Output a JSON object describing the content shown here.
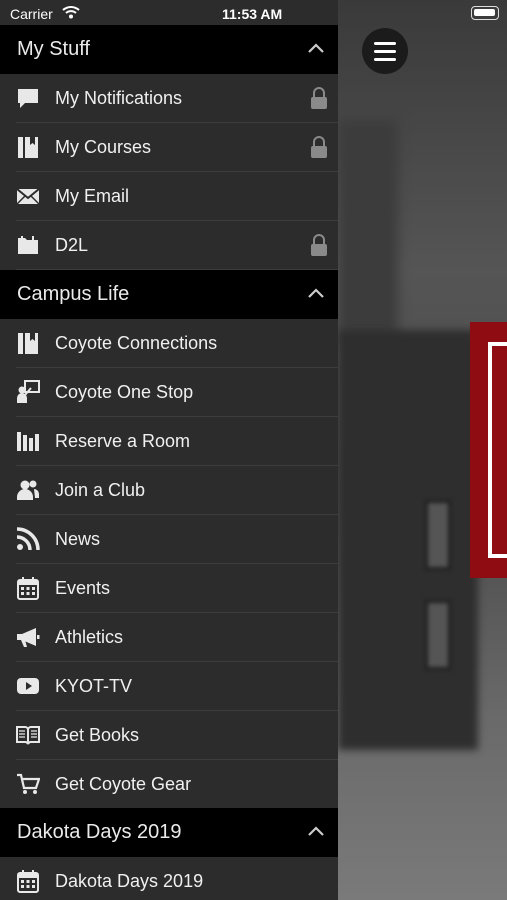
{
  "status_bar": {
    "carrier": "Carrier",
    "time": "11:53 AM"
  },
  "sections": [
    {
      "title": "My Stuff",
      "items": [
        {
          "label": "My Notifications",
          "icon": "chat-bubble-icon",
          "locked": true
        },
        {
          "label": "My Courses",
          "icon": "book-icon",
          "locked": true
        },
        {
          "label": "My Email",
          "icon": "envelope-icon",
          "locked": false
        },
        {
          "label": "D2L",
          "icon": "folder-icon",
          "locked": true
        }
      ]
    },
    {
      "title": "Campus Life",
      "items": [
        {
          "label": "Coyote Connections",
          "icon": "book-icon",
          "locked": false
        },
        {
          "label": "Coyote One Stop",
          "icon": "person-presentation-icon",
          "locked": false
        },
        {
          "label": "Reserve a Room",
          "icon": "library-icon",
          "locked": false
        },
        {
          "label": "Join a Club",
          "icon": "users-icon",
          "locked": false
        },
        {
          "label": "News",
          "icon": "rss-icon",
          "locked": false
        },
        {
          "label": "Events",
          "icon": "calendar-icon",
          "locked": false
        },
        {
          "label": "Athletics",
          "icon": "megaphone-icon",
          "locked": false
        },
        {
          "label": "KYOT-TV",
          "icon": "play-video-icon",
          "locked": false
        },
        {
          "label": "Get Books",
          "icon": "open-book-icon",
          "locked": false
        },
        {
          "label": "Get Coyote Gear",
          "icon": "cart-icon",
          "locked": false
        }
      ]
    },
    {
      "title": "Dakota Days 2019",
      "items": [
        {
          "label": "Dakota Days 2019",
          "icon": "calendar-icon",
          "locked": false
        }
      ]
    }
  ],
  "colors": {
    "drawer_bg": "#2c2c2c",
    "header_bg": "#000000",
    "accent_red": "#8e0c12"
  }
}
